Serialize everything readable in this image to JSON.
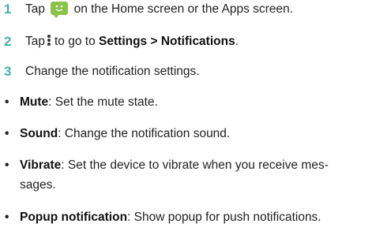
{
  "steps": [
    {
      "number": "1",
      "pre": "Tap",
      "icon": "messages-icon",
      "post": "on the Home screen or the Apps screen."
    },
    {
      "number": "2",
      "pre": "Tap",
      "icon": "more-options-icon",
      "mid": "to go to",
      "bold": "Settings > Notifications",
      "post": "."
    },
    {
      "number": "3",
      "text": "Change the notification settings."
    }
  ],
  "bullets": [
    {
      "symbol": "•",
      "term": "Mute",
      "desc": ": Set the mute state."
    },
    {
      "symbol": "•",
      "term": "Sound",
      "desc": ": Change the notification sound."
    },
    {
      "symbol": "•",
      "term": "Vibrate",
      "desc_line1": ": Set the device to vibrate when you receive mes-",
      "desc_line2": "sages."
    },
    {
      "symbol": "•",
      "term": "Popup notification",
      "desc": ": Show popup for push notifications."
    }
  ],
  "colors": {
    "step_number": "#3fb5a3",
    "messages_icon": "#8bc34a"
  }
}
